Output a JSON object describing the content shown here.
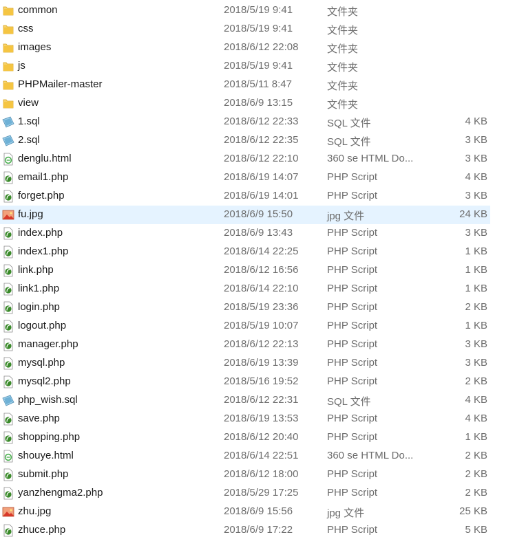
{
  "files": [
    {
      "name": "common",
      "date": "2018/5/19 9:41",
      "type": "文件夹",
      "size": "",
      "icon": "folder-icon",
      "selected": false
    },
    {
      "name": "css",
      "date": "2018/5/19 9:41",
      "type": "文件夹",
      "size": "",
      "icon": "folder-icon",
      "selected": false
    },
    {
      "name": "images",
      "date": "2018/6/12 22:08",
      "type": "文件夹",
      "size": "",
      "icon": "folder-icon",
      "selected": false
    },
    {
      "name": "js",
      "date": "2018/5/19 9:41",
      "type": "文件夹",
      "size": "",
      "icon": "folder-icon",
      "selected": false
    },
    {
      "name": "PHPMailer-master",
      "date": "2018/5/11 8:47",
      "type": "文件夹",
      "size": "",
      "icon": "folder-icon",
      "selected": false
    },
    {
      "name": "view",
      "date": "2018/6/9 13:15",
      "type": "文件夹",
      "size": "",
      "icon": "folder-icon",
      "selected": false
    },
    {
      "name": "1.sql",
      "date": "2018/6/12 22:33",
      "type": "SQL 文件",
      "size": "4 KB",
      "icon": "sql-file-icon",
      "selected": false
    },
    {
      "name": "2.sql",
      "date": "2018/6/12 22:35",
      "type": "SQL 文件",
      "size": "3 KB",
      "icon": "sql-file-icon",
      "selected": false
    },
    {
      "name": "denglu.html",
      "date": "2018/6/12 22:10",
      "type": "360 se HTML Do...",
      "size": "3 KB",
      "icon": "html-file-icon",
      "selected": false
    },
    {
      "name": "email1.php",
      "date": "2018/6/19 14:07",
      "type": "PHP Script",
      "size": "4 KB",
      "icon": "php-file-icon",
      "selected": false
    },
    {
      "name": "forget.php",
      "date": "2018/6/19 14:01",
      "type": "PHP Script",
      "size": "3 KB",
      "icon": "php-file-icon",
      "selected": false
    },
    {
      "name": "fu.jpg",
      "date": "2018/6/9 15:50",
      "type": "jpg 文件",
      "size": "24 KB",
      "icon": "image-file-icon",
      "selected": true
    },
    {
      "name": "index.php",
      "date": "2018/6/9 13:43",
      "type": "PHP Script",
      "size": "3 KB",
      "icon": "php-file-icon",
      "selected": false
    },
    {
      "name": "index1.php",
      "date": "2018/6/14 22:25",
      "type": "PHP Script",
      "size": "1 KB",
      "icon": "php-file-icon",
      "selected": false
    },
    {
      "name": "link.php",
      "date": "2018/6/12 16:56",
      "type": "PHP Script",
      "size": "1 KB",
      "icon": "php-file-icon",
      "selected": false
    },
    {
      "name": "link1.php",
      "date": "2018/6/14 22:10",
      "type": "PHP Script",
      "size": "1 KB",
      "icon": "php-file-icon",
      "selected": false
    },
    {
      "name": "login.php",
      "date": "2018/5/19 23:36",
      "type": "PHP Script",
      "size": "2 KB",
      "icon": "php-file-icon",
      "selected": false
    },
    {
      "name": "logout.php",
      "date": "2018/5/19 10:07",
      "type": "PHP Script",
      "size": "1 KB",
      "icon": "php-file-icon",
      "selected": false
    },
    {
      "name": "manager.php",
      "date": "2018/6/12 22:13",
      "type": "PHP Script",
      "size": "3 KB",
      "icon": "php-file-icon",
      "selected": false
    },
    {
      "name": "mysql.php",
      "date": "2018/6/19 13:39",
      "type": "PHP Script",
      "size": "3 KB",
      "icon": "php-file-icon",
      "selected": false
    },
    {
      "name": "mysql2.php",
      "date": "2018/5/16 19:52",
      "type": "PHP Script",
      "size": "2 KB",
      "icon": "php-file-icon",
      "selected": false
    },
    {
      "name": "php_wish.sql",
      "date": "2018/6/12 22:31",
      "type": "SQL 文件",
      "size": "4 KB",
      "icon": "sql-file-icon",
      "selected": false
    },
    {
      "name": "save.php",
      "date": "2018/6/19 13:53",
      "type": "PHP Script",
      "size": "4 KB",
      "icon": "php-file-icon",
      "selected": false
    },
    {
      "name": "shopping.php",
      "date": "2018/6/12 20:40",
      "type": "PHP Script",
      "size": "1 KB",
      "icon": "php-file-icon",
      "selected": false
    },
    {
      "name": "shouye.html",
      "date": "2018/6/14 22:51",
      "type": "360 se HTML Do...",
      "size": "2 KB",
      "icon": "html-file-icon",
      "selected": false
    },
    {
      "name": "submit.php",
      "date": "2018/6/12 18:00",
      "type": "PHP Script",
      "size": "2 KB",
      "icon": "php-file-icon",
      "selected": false
    },
    {
      "name": "yanzhengma2.php",
      "date": "2018/5/29 17:25",
      "type": "PHP Script",
      "size": "2 KB",
      "icon": "php-file-icon",
      "selected": false
    },
    {
      "name": "zhu.jpg",
      "date": "2018/6/9 15:56",
      "type": "jpg 文件",
      "size": "25 KB",
      "icon": "image-file-icon",
      "selected": false
    },
    {
      "name": "zhuce.php",
      "date": "2018/6/9 17:22",
      "type": "PHP Script",
      "size": "5 KB",
      "icon": "php-file-icon",
      "selected": false
    }
  ],
  "colors": {
    "selected_row": "#e5f3ff",
    "folder": "#f5c542",
    "php": "#3a8a2a",
    "sql": "#6fb1d6",
    "image": "#e0402a"
  }
}
